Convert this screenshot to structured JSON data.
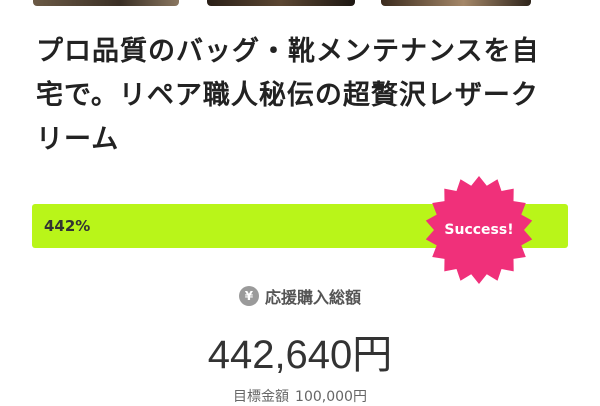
{
  "project": {
    "title": "プロ品質のバッグ・靴メンテナンスを自宅で。リペア職人秘伝の超贅沢レザークリーム"
  },
  "progress": {
    "percent_label": "442%",
    "percent": 442,
    "bar_color": "#b9f519"
  },
  "badge": {
    "label": "Success!",
    "color": "#f0307a"
  },
  "support": {
    "icon": "yen-icon",
    "icon_glyph": "¥",
    "label": "応援購入総額",
    "amount": "442,640円"
  },
  "goal": {
    "label": "目標金額",
    "amount": "100,000円"
  }
}
